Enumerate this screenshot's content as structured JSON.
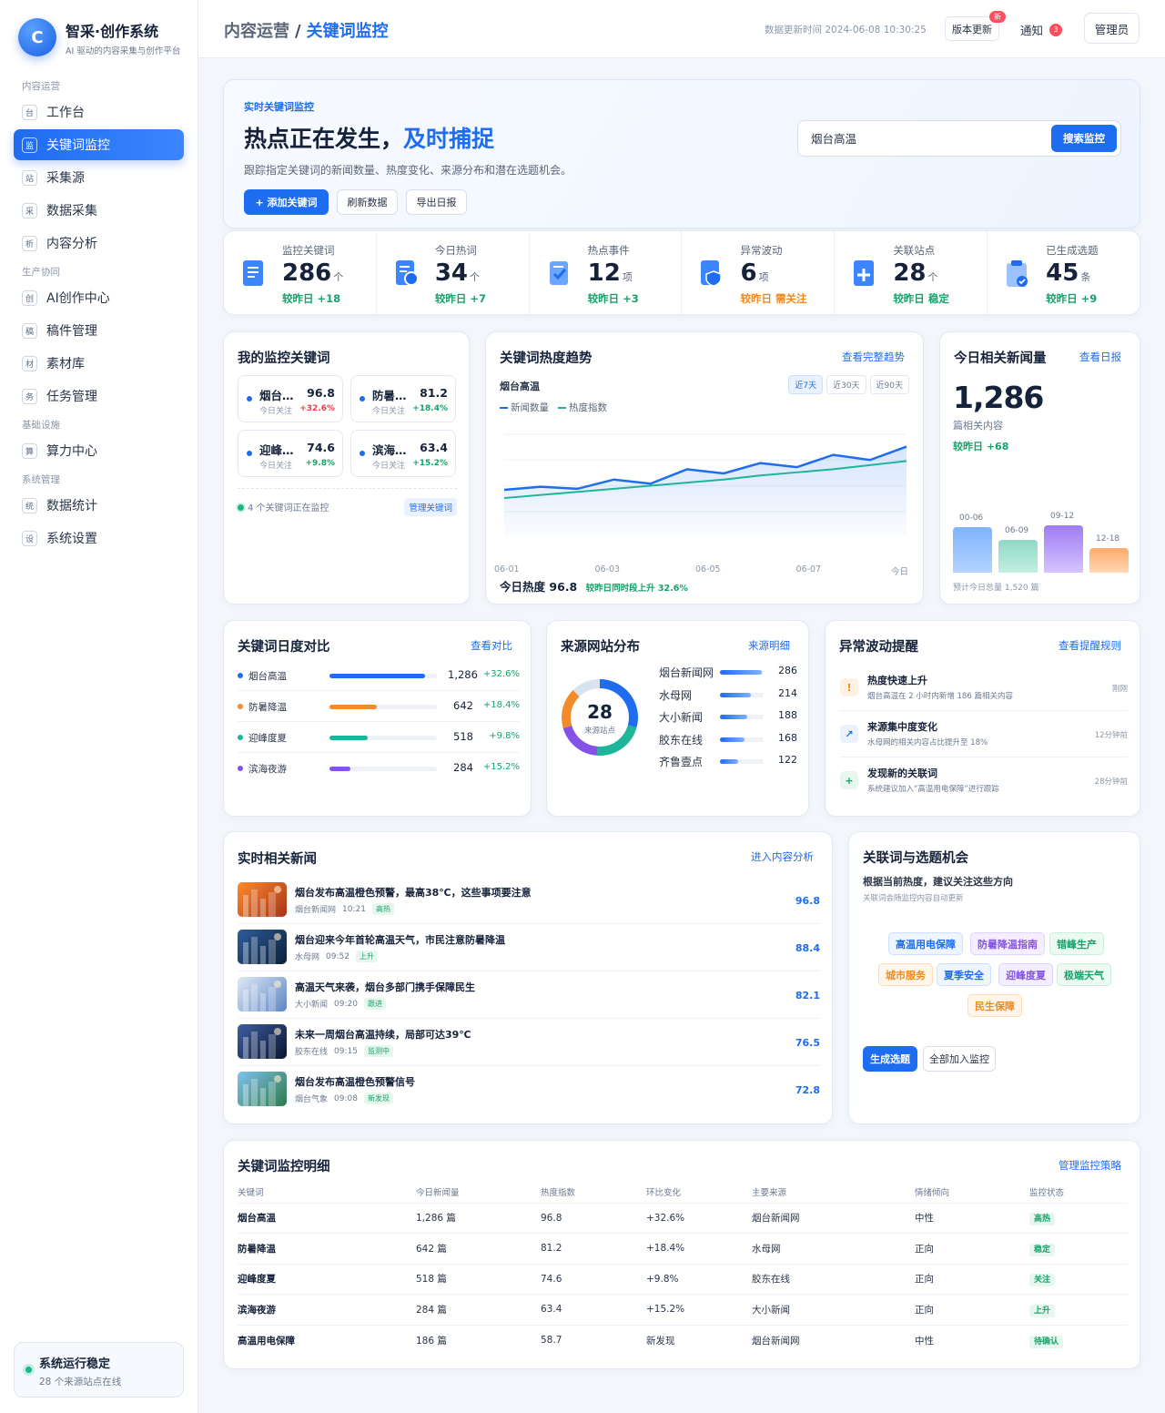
{
  "brand": {
    "logo_letter": "C",
    "title": "智采·创作系统",
    "subtitle": "AI 驱动的内容采集与创作平台"
  },
  "nav": {
    "sections": [
      {
        "label": "内容运营",
        "items": [
          {
            "icon": "台",
            "label": "工作台"
          },
          {
            "icon": "监",
            "label": "关键词监控",
            "active": true
          },
          {
            "icon": "站",
            "label": "采集源"
          },
          {
            "icon": "采",
            "label": "数据采集"
          },
          {
            "icon": "析",
            "label": "内容分析"
          }
        ]
      },
      {
        "label": "生产协同",
        "items": [
          {
            "icon": "创",
            "label": "AI创作中心"
          },
          {
            "icon": "稿",
            "label": "稿件管理"
          },
          {
            "icon": "材",
            "label": "素材库"
          },
          {
            "icon": "务",
            "label": "任务管理"
          }
        ]
      },
      {
        "label": "基础设施",
        "items": [
          {
            "icon": "算",
            "label": "算力中心"
          }
        ]
      },
      {
        "label": "系统管理",
        "items": [
          {
            "icon": "统",
            "label": "数据统计"
          },
          {
            "icon": "设",
            "label": "系统设置"
          }
        ]
      }
    ]
  },
  "system_status": {
    "title": "系统运行稳定",
    "subtitle": "28 个来源站点在线"
  },
  "topbar": {
    "crumb_parent": "内容运营",
    "crumb_sep": "/",
    "crumb_current": "关键词监控",
    "update_time": "数据更新时间 2024-06-08 10:30:25",
    "version_label": "版本更新",
    "version_badge": "新",
    "notice_label": "通知",
    "notice_count": "3",
    "admin_label": "管理员"
  },
  "hero": {
    "tag": "实时关键词监控",
    "title_a": "热点正在发生，",
    "title_b": "及时捕捉",
    "desc": "跟踪指定关键词的新闻数量、热度变化、来源分布和潜在选题机会。",
    "btn_add": "+ 添加关键词",
    "btn_refresh": "刷新数据",
    "btn_export": "导出日报",
    "search_value": "烟台高温",
    "search_btn": "搜索监控"
  },
  "stats": [
    {
      "label": "监控关键词",
      "value": "286",
      "unit": "个",
      "delta": "较昨日 +18",
      "tone": "good",
      "color": "#2d7df6"
    },
    {
      "label": "今日热词",
      "value": "34",
      "unit": "个",
      "delta": "较昨日 +7",
      "tone": "good",
      "color": "#2d7df6"
    },
    {
      "label": "热点事件",
      "value": "12",
      "unit": "项",
      "delta": "较昨日 +3",
      "tone": "good",
      "color": "#2d7df6"
    },
    {
      "label": "异常波动",
      "value": "6",
      "unit": "项",
      "delta": "较昨日 需关注",
      "tone": "warn",
      "color": "#2d7df6"
    },
    {
      "label": "关联站点",
      "value": "28",
      "unit": "个",
      "delta": "较昨日 稳定",
      "tone": "good",
      "color": "#2d7df6"
    },
    {
      "label": "已生成选题",
      "value": "45",
      "unit": "条",
      "delta": "较昨日 +9",
      "tone": "good",
      "color": "#2d7df6"
    }
  ],
  "my_keywords": {
    "title": "我的监控关键词",
    "items": [
      {
        "name": "烟台高温",
        "score": "96.8",
        "sub": "今日关注",
        "change": "+32.6%",
        "tone": "red"
      },
      {
        "name": "防暑降温",
        "score": "81.2",
        "sub": "今日关注",
        "change": "+18.4%",
        "tone": "good"
      },
      {
        "name": "迎峰度夏",
        "score": "74.6",
        "sub": "今日关注",
        "change": "+9.8%",
        "tone": "good"
      },
      {
        "name": "滨海夜游",
        "score": "63.4",
        "sub": "今日关注",
        "change": "+15.2%",
        "tone": "good"
      }
    ],
    "footer": "4 个关键词正在监控",
    "manage": "管理关键词"
  },
  "trend": {
    "title": "关键词热度趋势",
    "link": "查看完整趋势",
    "keyword": "烟台高温",
    "ranges": [
      "近7天",
      "近30天",
      "近90天"
    ],
    "footer_label": "今日热度",
    "footer_value": "96.8",
    "footer_note": "较昨日同时段上升 32.6%"
  },
  "chart_data": {
    "type": "line",
    "x": [
      "06-01",
      "06-02",
      "06-03",
      "06-04",
      "06-05",
      "06-06",
      "06-07",
      "06-08",
      "06-09",
      "06-10",
      "06-11",
      "今日"
    ],
    "x_tick_labels": [
      "06-01",
      "06-03",
      "06-05",
      "06-07",
      "今日"
    ],
    "series": [
      {
        "name": "新闻数量",
        "color": "#1e6cf0",
        "values": [
          46,
          49,
          47,
          56,
          52,
          66,
          62,
          72,
          68,
          80,
          75,
          88
        ]
      },
      {
        "name": "热度指数",
        "color": "#1fb59a",
        "values": [
          38,
          41,
          44,
          47,
          50,
          53,
          56,
          60,
          63,
          66,
          70,
          74
        ]
      }
    ],
    "ylim": [
      0,
      100
    ],
    "grid": true,
    "legend": "top-left"
  },
  "news_count": {
    "title": "今日相关新闻量",
    "link": "查看日报",
    "value": "1,286",
    "sub": "篇相关内容",
    "delta": "较昨日 +68",
    "bars": [
      {
        "label": "00-06",
        "value": 320,
        "color_a": "#b3d4ff",
        "color_b": "#7fb3ff"
      },
      {
        "label": "06-09",
        "value": 230,
        "color_a": "#c4eee2",
        "color_b": "#8fd9c4"
      },
      {
        "label": "09-12",
        "value": 330,
        "color_a": "#d6c3ff",
        "color_b": "#9f7cf5"
      },
      {
        "label": "12-18",
        "value": 170,
        "color_a": "#ffd7b3",
        "color_b": "#ffab6b"
      }
    ],
    "footer": "预计今日总量 1,520 篇"
  },
  "compare": {
    "title": "关键词日度对比",
    "link": "查看对比",
    "rows": [
      {
        "name": "烟台高温",
        "value": 1286,
        "change": "+32.6%",
        "color": "#1e6cf0"
      },
      {
        "name": "防暑降温",
        "value": 642,
        "change": "+18.4%",
        "color": "#f58a2a"
      },
      {
        "name": "迎峰度夏",
        "value": 518,
        "change": "+9.8%",
        "color": "#1fb59a"
      },
      {
        "name": "滨海夜游",
        "value": 284,
        "change": "+15.2%",
        "color": "#8452e6"
      }
    ],
    "max": 1450
  },
  "sources": {
    "title": "来源网站分布",
    "link": "来源明细",
    "count": "28",
    "count_label": "来源站点",
    "rows": [
      {
        "name": "烟台新闻网",
        "value": 286,
        "color": "#1e6cf0"
      },
      {
        "name": "水母网",
        "value": 214,
        "color": "#1fb59a"
      },
      {
        "name": "大小新闻",
        "value": 188,
        "color": "#8452e6"
      },
      {
        "name": "胶东在线",
        "value": 168,
        "color": "#f58a2a"
      },
      {
        "name": "齐鲁壹点",
        "value": 122,
        "color": "#d9e3f0"
      }
    ],
    "max": 300
  },
  "alerts": {
    "title": "异常波动提醒",
    "link": "查看提醒规则",
    "rows": [
      {
        "icon": "!",
        "bg": "#fff1e1",
        "fg": "#f08a1c",
        "title": "热度快速上升",
        "sub": "烟台高温在 2 小时内新增 186 篇相关内容",
        "time": "刚刚"
      },
      {
        "icon": "↗",
        "bg": "#eaf2ff",
        "fg": "#1e6cf0",
        "title": "来源集中度变化",
        "sub": "水母网的相关内容占比提升至 18%",
        "time": "12分钟前"
      },
      {
        "icon": "+",
        "bg": "#e7f7ef",
        "fg": "#16a36a",
        "title": "发现新的关联词",
        "sub": "系统建议加入“高温用电保障”进行跟踪",
        "time": "28分钟前"
      }
    ]
  },
  "realtime_news": {
    "title": "实时相关新闻",
    "link": "进入内容分析",
    "rows": [
      {
        "title": "烟台发布高温橙色预警，最高38℃，这些事项要注意",
        "source": "烟台新闻网",
        "time": "10:21",
        "tag": "高热",
        "score": "96.8",
        "thumb_a": "#ff8a2a",
        "thumb_b": "#a8341a"
      },
      {
        "title": "烟台迎来今年首轮高温天气，市民注意防暑降温",
        "source": "水母网",
        "time": "09:52",
        "tag": "上升",
        "score": "88.4",
        "thumb_a": "#2c5d9c",
        "thumb_b": "#0e2038"
      },
      {
        "title": "高温天气来袭，烟台多部门携手保障民生",
        "source": "大小新闻",
        "time": "09:20",
        "tag": "跟进",
        "score": "82.1",
        "thumb_a": "#dfe9f7",
        "thumb_b": "#5d86c4"
      },
      {
        "title": "未来一周烟台高温持续，局部可达39℃",
        "source": "胶东在线",
        "time": "09:15",
        "tag": "监测中",
        "score": "76.5",
        "thumb_a": "#3d5fa0",
        "thumb_b": "#0b1530"
      },
      {
        "title": "烟台发布高温橙色预警信号",
        "source": "烟台气象",
        "time": "09:08",
        "tag": "新发现",
        "score": "72.8",
        "thumb_a": "#7ec3f0",
        "thumb_b": "#2f7a4a"
      }
    ]
  },
  "opportunities": {
    "title": "关联词与选题机会",
    "subtitle": "根据当前热度，建议关注这些方向",
    "note": "关联词会随监控内容自动更新",
    "chips": [
      {
        "label": "高温用电保障",
        "fg": "#1e6cf0",
        "bg": "#eef5ff",
        "bd": "#cfe0ff"
      },
      {
        "label": "防暑降温指南",
        "fg": "#8452e6",
        "bg": "#f4efff",
        "bd": "#e0d3ff"
      },
      {
        "label": "错峰生产",
        "fg": "#16a36a",
        "bg": "#ecfaf3",
        "bd": "#c9eedb"
      },
      {
        "label": "城市服务",
        "fg": "#f08a1c",
        "bg": "#fff5ea",
        "bd": "#ffdcb8"
      },
      {
        "label": "夏季安全",
        "fg": "#1e6cf0",
        "bg": "#eef5ff",
        "bd": "#cfe0ff"
      },
      {
        "label": "迎峰度夏",
        "fg": "#8452e6",
        "bg": "#f4efff",
        "bd": "#e0d3ff"
      },
      {
        "label": "极端天气",
        "fg": "#16a36a",
        "bg": "#ecfaf3",
        "bd": "#c9eedb"
      },
      {
        "label": "民生保障",
        "fg": "#f08a1c",
        "bg": "#fff5ea",
        "bd": "#ffdcb8"
      }
    ],
    "btn_generate": "生成选题",
    "btn_add_all": "全部加入监控"
  },
  "detail": {
    "title": "关键词监控明细",
    "link": "管理监控策略",
    "columns": [
      "关键词",
      "今日新闻量",
      "热度指数",
      "环比变化",
      "主要来源",
      "情绪倾向",
      "监控状态"
    ],
    "rows": [
      [
        "烟台高温",
        "1,286 篇",
        "96.8",
        "+32.6%",
        "烟台新闻网",
        "中性",
        "高热"
      ],
      [
        "防暑降温",
        "642 篇",
        "81.2",
        "+18.4%",
        "水母网",
        "正向",
        "稳定"
      ],
      [
        "迎峰度夏",
        "518 篇",
        "74.6",
        "+9.8%",
        "胶东在线",
        "正向",
        "关注"
      ],
      [
        "滨海夜游",
        "284 篇",
        "63.4",
        "+15.2%",
        "大小新闻",
        "正向",
        "上升"
      ],
      [
        "高温用电保障",
        "186 篇",
        "58.7",
        "新发现",
        "烟台新闻网",
        "中性",
        "待确认"
      ]
    ]
  }
}
